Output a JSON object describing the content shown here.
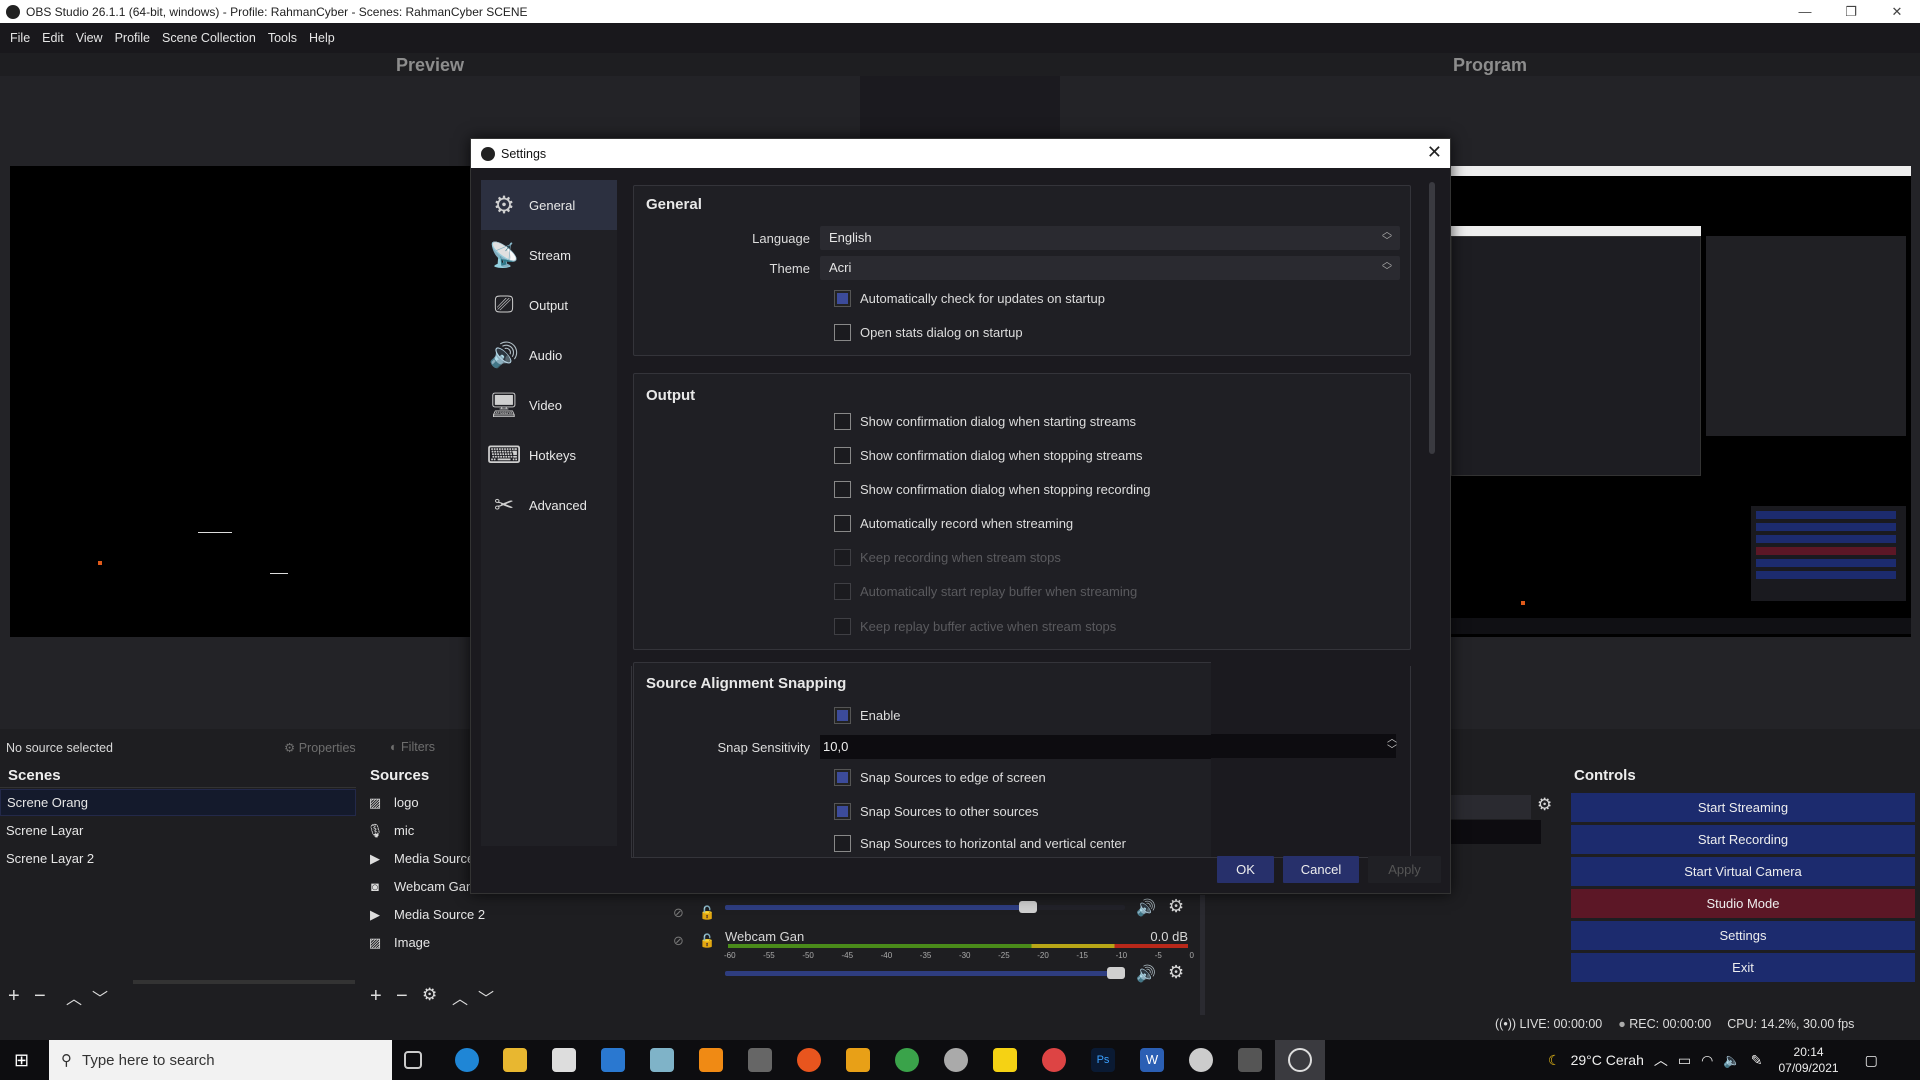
{
  "window": {
    "title": "OBS Studio 26.1.1 (64-bit, windows) - Profile: RahmanCyber - Scenes: RahmanCyber SCENE"
  },
  "menu": [
    "File",
    "Edit",
    "View",
    "Profile",
    "Scene Collection",
    "Tools",
    "Help"
  ],
  "preview": {
    "label": "Preview"
  },
  "program": {
    "label": "Program"
  },
  "settings": {
    "title": "Settings",
    "sidebar": [
      {
        "label": "General",
        "icon": "gear-icon",
        "selected": true
      },
      {
        "label": "Stream",
        "icon": "antenna-icon"
      },
      {
        "label": "Output",
        "icon": "output-monitor-icon"
      },
      {
        "label": "Audio",
        "icon": "speaker-icon"
      },
      {
        "label": "Video",
        "icon": "monitor-icon"
      },
      {
        "label": "Hotkeys",
        "icon": "keyboard-icon"
      },
      {
        "label": "Advanced",
        "icon": "tools-icon"
      }
    ],
    "general": {
      "title": "General",
      "language_label": "Language",
      "language_value": "English",
      "theme_label": "Theme",
      "theme_value": "Acri",
      "check_updates": {
        "label": "Automatically check for updates on startup",
        "checked": true
      },
      "open_stats": {
        "label": "Open stats dialog on startup",
        "checked": false
      }
    },
    "output": {
      "title": "Output",
      "items": [
        {
          "label": "Show confirmation dialog when starting streams",
          "checked": false,
          "enabled": true
        },
        {
          "label": "Show confirmation dialog when stopping streams",
          "checked": false,
          "enabled": true
        },
        {
          "label": "Show confirmation dialog when stopping recording",
          "checked": false,
          "enabled": true
        },
        {
          "label": "Automatically record when streaming",
          "checked": false,
          "enabled": true
        },
        {
          "label": "Keep recording when stream stops",
          "checked": false,
          "enabled": false
        },
        {
          "label": "Automatically start replay buffer when streaming",
          "checked": false,
          "enabled": false
        },
        {
          "label": "Keep replay buffer active when stream stops",
          "checked": false,
          "enabled": false
        }
      ]
    },
    "snapping": {
      "title": "Source Alignment Snapping",
      "enable": {
        "label": "Enable",
        "checked": true
      },
      "sensitivity_label": "Snap Sensitivity",
      "sensitivity_value": "10,0",
      "edge": {
        "label": "Snap Sources to edge of screen",
        "checked": true
      },
      "other": {
        "label": "Snap Sources to other sources",
        "checked": true
      },
      "center": {
        "label": "Snap Sources to horizontal and vertical center",
        "checked": false
      }
    },
    "buttons": {
      "ok": "OK",
      "cancel": "Cancel",
      "apply": "Apply"
    }
  },
  "source_toolbar": {
    "status": "No source selected",
    "properties": "Properties",
    "filters": "Filters"
  },
  "scenes": {
    "title": "Scenes",
    "items": [
      "Screne Orang",
      "Screne Layar",
      "Screne Layar 2"
    ],
    "selected": "Screne Orang"
  },
  "sources": {
    "title": "Sources",
    "items": [
      {
        "label": "logo",
        "icon": "image-icon"
      },
      {
        "label": "mic",
        "icon": "microphone-icon"
      },
      {
        "label": "Media Source",
        "icon": "play-icon"
      },
      {
        "label": "Webcam Gan",
        "icon": "camera-icon"
      },
      {
        "label": "Media Source 2",
        "icon": "play-icon"
      },
      {
        "label": "Image",
        "icon": "image-icon"
      }
    ]
  },
  "mixer": {
    "channel_top_volume": 0.77,
    "channel": {
      "name": "Webcam Gan",
      "level": "0.0 dB",
      "volume": 1.0
    },
    "ticks": [
      "-60",
      "-55",
      "-50",
      "-45",
      "-40",
      "-35",
      "-30",
      "-25",
      "-20",
      "-15",
      "-10",
      "-5",
      "0"
    ]
  },
  "controls": {
    "title": "Controls",
    "buttons": [
      "Start Streaming",
      "Start Recording",
      "Start Virtual Camera",
      "Studio Mode",
      "Settings",
      "Exit"
    ],
    "colors": {
      "default": "#1c2b6e",
      "studio_mode": "#5c1726"
    }
  },
  "status": {
    "live": "LIVE: 00:00:00",
    "rec": "REC: 00:00:00",
    "cpu": "CPU: 14.2%, 30.00 fps"
  },
  "taskbar": {
    "search_placeholder": "Type here to search",
    "weather": "29°C  Cerah",
    "time": "20:14",
    "date": "07/09/2021"
  }
}
